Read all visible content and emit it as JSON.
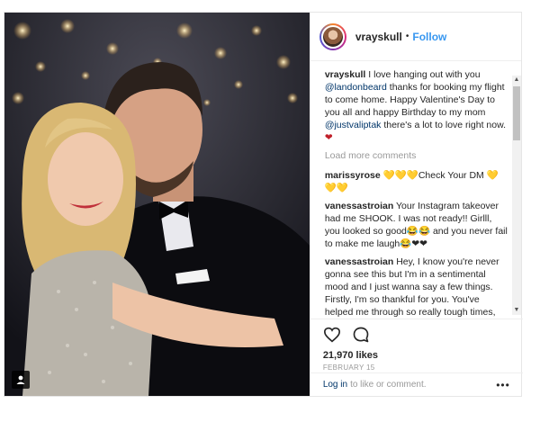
{
  "header": {
    "username": "vrayskull",
    "separator": "•",
    "follow_label": "Follow"
  },
  "caption": {
    "username": "vrayskull",
    "text_1": " I love hanging out with you ",
    "mention_1": "@landonbeard",
    "text_2": " thanks for booking my flight to come home. Happy Valentine's Day to you all and happy Birthday to my mom ",
    "mention_2": "@justvaliptak",
    "text_3": " there's a lot to love right now.",
    "emoji": "❤"
  },
  "load_more_label": "Load more comments",
  "comments": [
    {
      "user": "marissyrose",
      "text": " 💛💛💛Check Your DM 💛💛💛"
    },
    {
      "user": "vanessastroian",
      "text": " Your Instagram takeover had me SHOOK. I was not ready!! Girlll, you looked so good😂😂 and you never fail to make me laugh😂❤❤"
    },
    {
      "user": "vanessastroian",
      "text": " Hey, I know you're never gonna see this but I'm in a sentimental mood and I just wanna say a few things. Firstly, I'm so thankful for you. You've helped me through so really tough times, even if it's just that I'm having a bad day, but I tell myself that I can go home and watch blue bloods or see if you've posted"
    }
  ],
  "likes": "21,970 likes",
  "date": "February 15",
  "login": {
    "link": "Log in",
    "text": "to like or comment."
  },
  "more_label": "•••",
  "icons": {
    "heart": "heart-icon",
    "comment": "comment-icon",
    "tag": "user-tag-icon",
    "more": "more-options-icon"
  }
}
